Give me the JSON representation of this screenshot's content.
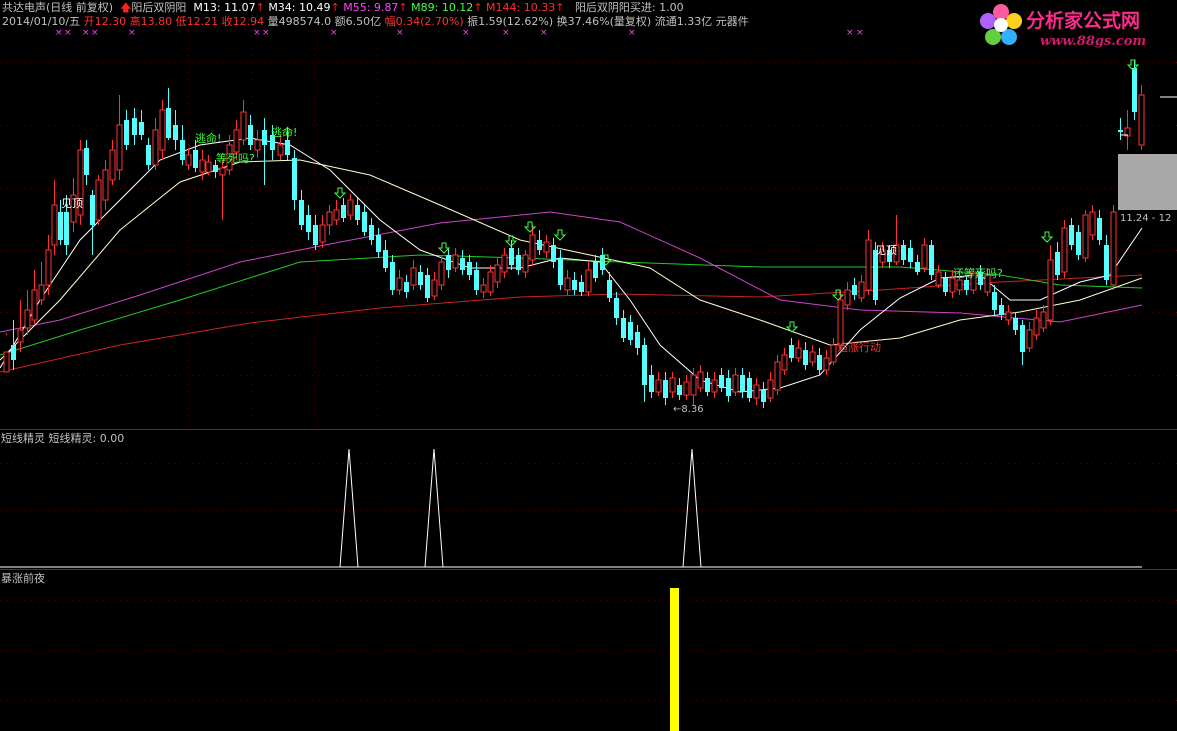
{
  "header": {
    "stock_name": "共达电声",
    "period_info": "(日线 前复权)",
    "indicator_name": "阳后双阴阳",
    "ma": [
      {
        "label": "M13: 11.07",
        "color": "#ffffff"
      },
      {
        "label": "M34: 10.49",
        "color": "#ffffff"
      },
      {
        "label": "M55: 9.87",
        "color": "#ff40ff"
      },
      {
        "label": "M89: 10.12",
        "color": "#40ff40"
      },
      {
        "label": "M144: 10.33",
        "color": "#ff3030"
      }
    ],
    "signal_text": "阳后双阴阳买进: 1.00",
    "date": "2014/01/10/五",
    "open": "开12.30",
    "high": "高13.80",
    "low": "低12.21",
    "close": "收12.94",
    "volume": "量498574.0",
    "amount": "额6.50亿",
    "change": "幅0.34(2.70%)",
    "amplitude": "振1.59(12.62%)",
    "turnover": "换37.46%(量复权)",
    "float": "流通1.33亿",
    "industry": "元器件"
  },
  "logo": {
    "text": "分析家公式网",
    "url": "www.88gs.com"
  },
  "annotations": {
    "escape1": "逃命!",
    "escape2": "逃命!",
    "wait_die": "等死吗?",
    "top1": "见顶",
    "top2": "见顶",
    "wait_die2": "还等死吗?",
    "chase": "追涨行动",
    "low_price": "←8.36",
    "price_tag": "11.24 - 12"
  },
  "panels": {
    "panel2_title": "短线精灵  短线精灵: 0.00",
    "panel3_title": "暴涨前夜"
  },
  "colors": {
    "up": "#ff3232",
    "down": "#54ffff",
    "ma13": "#ffffff",
    "ma34": "#ffffcc",
    "ma55": "#cc44cc",
    "ma89": "#22cc22",
    "ma144": "#cc2222"
  }
}
